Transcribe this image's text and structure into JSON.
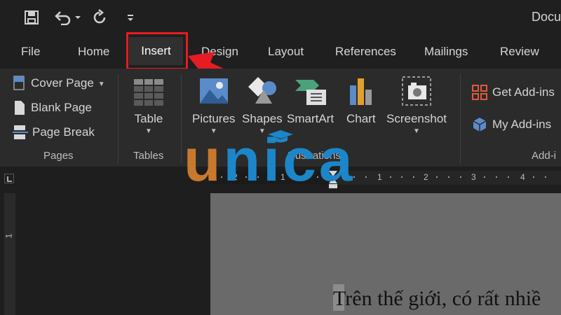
{
  "window": {
    "title": "Docu"
  },
  "quick_access": {
    "save_icon": "save-icon",
    "undo_icon": "undo-icon",
    "redo_icon": "redo-icon",
    "customize_icon": "customize-qat-icon"
  },
  "tabs": [
    {
      "label": "File"
    },
    {
      "label": "Home"
    },
    {
      "label": "Insert"
    },
    {
      "label": "Design"
    },
    {
      "label": "Layout"
    },
    {
      "label": "References"
    },
    {
      "label": "Mailings"
    },
    {
      "label": "Review"
    }
  ],
  "ribbon": {
    "pages": {
      "label": "Pages",
      "cover_page": "Cover Page",
      "blank_page": "Blank Page",
      "page_break": "Page Break"
    },
    "tables": {
      "label": "Tables",
      "table": "Table"
    },
    "illustrations": {
      "label": "Illustrations",
      "pictures": "Pictures",
      "shapes": "Shapes",
      "smartart": "SmartArt",
      "chart": "Chart",
      "screenshot": "Screenshot"
    },
    "addins": {
      "label": "Add-i",
      "get_addins": "Get Add-ins",
      "my_addins": "My Add-ins"
    }
  },
  "ruler": {
    "h_labels": [
      "2",
      "1",
      "1",
      "2",
      "3",
      "4"
    ],
    "v_label": "1"
  },
  "document": {
    "text": "Trên thế giới, có rất nhiề"
  },
  "watermark": {
    "first": "u",
    "rest": "nica"
  },
  "colors": {
    "accent_highlight": "#e51c23",
    "watermark_orange": "#c8792d",
    "watermark_blue": "#1c86c9"
  }
}
